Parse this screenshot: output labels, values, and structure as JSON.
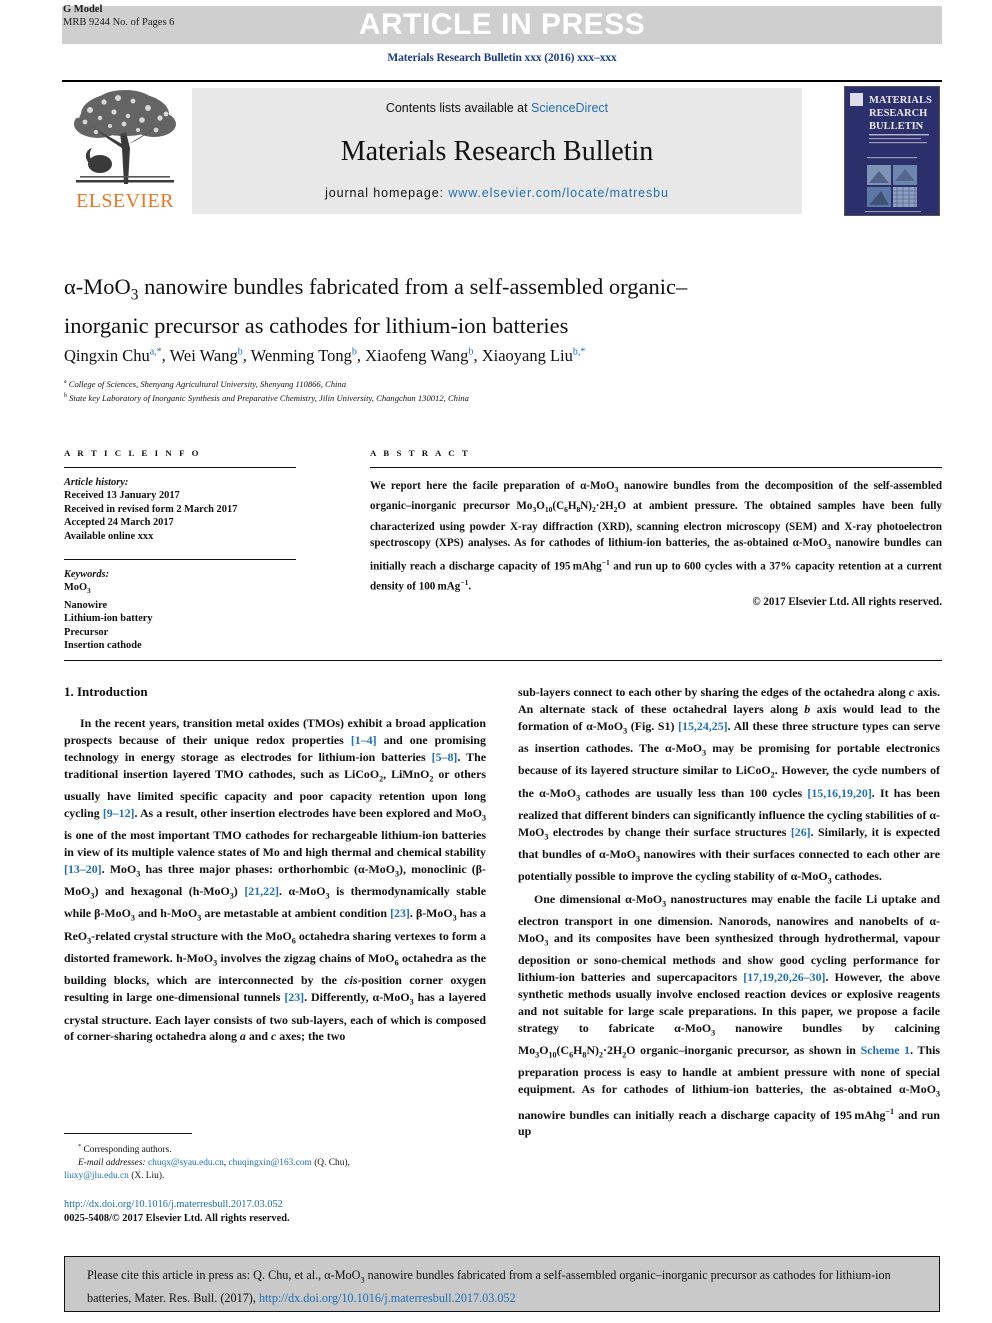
{
  "banner": {
    "aip_label": "ARTICLE IN PRESS",
    "g_model_label": "G Model",
    "g_model_id": "MRB 9244 No. of Pages 6",
    "banner_bg": "#cfcfcf"
  },
  "journal": {
    "citation_line": "Materials Research Bulletin xxx (2016) xxx–xxx",
    "contents_prefix": "Contents lists available at ",
    "contents_link": "ScienceDirect",
    "name": "Materials Research Bulletin",
    "homepage_prefix": "journal homepage: ",
    "homepage_url": "www.elsevier.com/locate/matresbu",
    "publisher": "ELSEVIER",
    "cover_title_lines": [
      "MATERIALS",
      "RESEARCH",
      "BULLETIN"
    ],
    "link_color": "#1f6fb5",
    "citation_color": "#1a3a8f",
    "publisher_color": "#e87722"
  },
  "article": {
    "title_line1": "α-MoO3 nanowire bundles fabricated from a self-assembled organic–",
    "title_line2": "inorganic precursor as cathodes for lithium-ion batteries",
    "authors": [
      {
        "name": "Qingxin Chu",
        "marks": "a,*"
      },
      {
        "name": "Wei Wang",
        "marks": "b"
      },
      {
        "name": "Wenming Tong",
        "marks": "b"
      },
      {
        "name": "Xiaofeng Wang",
        "marks": "b"
      },
      {
        "name": "Xiaoyang Liu",
        "marks": "b,*"
      }
    ],
    "affiliations": [
      {
        "mark": "a",
        "text": "College of Sciences, Shenyang Agricultural University, Shenyang 110866, China"
      },
      {
        "mark": "b",
        "text": "State key Laboratory of Inorganic Synthesis and Preparative Chemistry, Jilin University, Changchun 130012, China"
      }
    ]
  },
  "article_info": {
    "heading": "A R T I C L E   I N F O",
    "history_label": "Article history:",
    "history": [
      "Received 13 January 2017",
      "Received in revised form 2 March 2017",
      "Accepted 24 March 2017",
      "Available online xxx"
    ],
    "keywords_label": "Keywords:",
    "keywords": [
      "MoO3",
      "Nanowire",
      "Lithium-ion battery",
      "Precursor",
      "Insertion cathode"
    ]
  },
  "abstract": {
    "heading": "A B S T R A C T",
    "text": "We report here the facile preparation of α-MoO3 nanowire bundles from the decomposition of the self-assembled organic–inorganic precursor Mo3O10(C6H8N)2·2H2O at ambient pressure. The obtained samples have been fully characterized using powder X-ray diffraction (XRD), scanning electron microscopy (SEM) and X-ray photoelectron spectroscopy (XPS) analyses. As for cathodes of lithium-ion batteries, the as-obtained α-MoO3 nanowire bundles can initially reach a discharge capacity of 195 mAhg−1 and run up to 600 cycles with a 37% capacity retention at a current density of 100 mAg−1.",
    "copyright": "© 2017 Elsevier Ltd. All rights reserved."
  },
  "body": {
    "section_heading": "1. Introduction",
    "left_paragraph_1": "In the recent years, transition metal oxides (TMOs) exhibit a broad application prospects because of their unique redox properties [1–4] and one promising technology in energy storage as electrodes for lithium-ion batteries [5–8]. The traditional insertion layered TMO cathodes, such as LiCoO2, LiMnO2 or others usually have limited specific capacity and poor capacity retention upon long cycling [9–12]. As a result, other insertion electrodes have been explored and MoO3 is one of the most important TMO cathodes for rechargeable lithium-ion batteries in view of its multiple valence states of Mo and high thermal and chemical stability [13–20]. MoO3 has three major phases: orthorhombic (α-MoO3), monoclinic (β-MoO3) and hexagonal (h-MoO3) [21,22]. α-MoO3 is thermodynamically stable while β-MoO3 and h-MoO3 are metastable at ambient condition [23]. β-MoO3 has a ReO3-related crystal structure with the MoO6 octahedra sharing vertexes to form a distorted framework. h-MoO3 involves the zigzag chains of MoO6 octahedra as the building blocks, which are interconnected by the cis-position corner oxygen resulting in large one-dimensional tunnels [23]. Differently, α-MoO3 has a layered crystal structure. Each layer consists of two sub-layers, each of which is composed of corner-sharing octahedra along a and c axes; the two",
    "right_paragraph_1": "sub-layers connect to each other by sharing the edges of the octahedra along c axis. An alternate stack of these octahedral layers along b axis would lead to the formation of α-MoO3 (Fig. S1) [15,24,25]. All these three structure types can serve as insertion cathodes. The α-MoO3 may be promising for portable electronics because of its layered structure similar to LiCoO2. However, the cycle numbers of the α-MoO3 cathodes are usually less than 100 cycles [15,16,19,20]. It has been realized that different binders can significantly influence the cycling stabilities of α-MoO3 electrodes by change their surface structures [26]. Similarly, it is expected that bundles of α-MoO3 nanowires with their surfaces connected to each other are potentially possible to improve the cycling stability of α-MoO3 cathodes.",
    "right_paragraph_2": "One dimensional α-MoO3 nanostructures may enable the facile Li uptake and electron transport in one dimension. Nanorods, nanowires and nanobelts of α-MoO3 and its composites have been synthesized through hydrothermal, vapour deposition or sono-chemical methods and show good cycling performance for lithium-ion batteries and supercapacitors [17,19,20,26–30]. However, the above synthetic methods usually involve enclosed reaction devices or explosive reagents and not suitable for large scale preparations. In this paper, we propose a facile strategy to fabricate α-MoO3 nanowire bundles by calcining Mo3O10(C6H8N)2·2H2O organic–inorganic precursor, as shown in Scheme 1. This preparation process is easy to handle at ambient pressure with none of special equipment. As for cathodes of lithium-ion batteries, the as-obtained α-MoO3 nanowire bundles can initially reach a discharge capacity of 195 mAhg−1 and run up"
  },
  "footnotes": {
    "corresponding_marker": "*",
    "corresponding_label": "Corresponding authors.",
    "email_label": "E-mail addresses:",
    "email_1": "chuqx@syau.edu.cn",
    "email_2": "chuqingxin@163.com",
    "email_1_owner": "(Q. Chu),",
    "email_3": "liuxy@jlu.edu.cn",
    "email_3_owner": "(X. Liu).",
    "doi_url": "http://dx.doi.org/10.1016/j.materresbull.2017.03.052",
    "issn_line": "0025-5408/© 2017 Elsevier Ltd. All rights reserved."
  },
  "cite_box": {
    "text_before_link": "Please cite this article in press as: Q. Chu, et al., α-MoO3 nanowire bundles fabricated from a self-assembled organic–inorganic precursor as cathodes for lithium-ion batteries, Mater. Res. Bull. (2017), ",
    "link": "http://dx.doi.org/10.1016/j.materresbull.2017.03.052",
    "bg": "#c9c9c9"
  }
}
